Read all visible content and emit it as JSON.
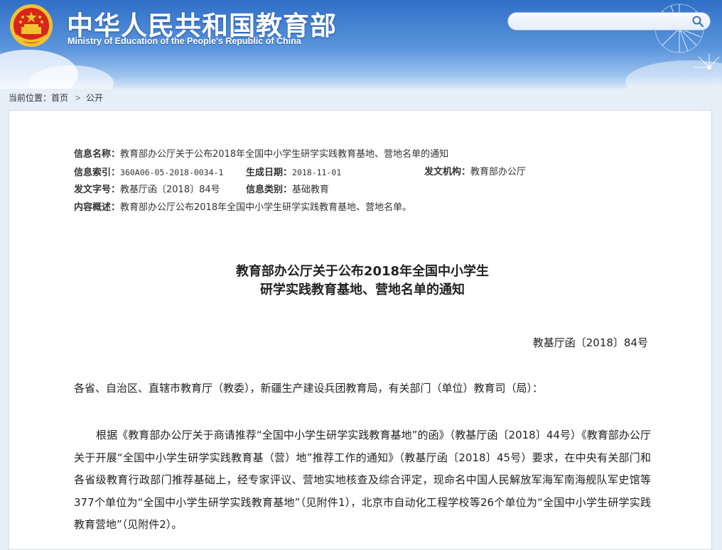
{
  "header": {
    "title": "中华人民共和国教育部",
    "subtitle": "Ministry of Education of the People's Republic of China",
    "search_placeholder": ""
  },
  "breadcrumb": {
    "prefix": "当前位置：",
    "items": [
      "首页",
      "公开"
    ]
  },
  "meta": {
    "info_name_label": "信息名称：",
    "info_name_value": "教育部办公厅关于公布2018年全国中小学生研学实践教育基地、营地名单的通知",
    "index_label": "信息索引：",
    "index_value": "360A06-05-2018-0034-1",
    "date_label": "生成日期：",
    "date_value": "2018-11-01",
    "issuer_label": "发文机构：",
    "issuer_value": "教育部办公厅",
    "doc_no_label": "发文字号：",
    "doc_no_value": "教基厅函〔2018〕84号",
    "category_label": "信息类别：",
    "category_value": "基础教育",
    "summary_label": "内容概述：",
    "summary_value": "教育部办公厅公布2018年全国中小学生研学实践教育基地、营地名单。"
  },
  "document": {
    "title_line1": "教育部办公厅关于公布2018年全国中小学生",
    "title_line2": "研学实践教育基地、营地名单的通知",
    "doc_number": "教基厅函〔2018〕84号",
    "salutation": "各省、自治区、直辖市教育厅（教委），新疆生产建设兵团教育局，有关部门（单位）教育司（局）：",
    "paragraph1": "根据《教育部办公厅关于商请推荐“全国中小学生研学实践教育基地”的函》（教基厅函〔2018〕44号）《教育部办公厅关于开展“全国中小学生研学实践教育基（营）地”推荐工作的通知》（教基厅函〔2018〕45号）要求，在中央有关部门和各省级教育行政部门推荐基础上，经专家评议、营地实地核查及综合评定，现命名中国人民解放军海军南海舰队军史馆等377个单位为“全国中小学生研学实践教育基地”（见附件1），北京市自动化工程学校等26个单位为“全国中小学生研学实践教育营地”（见附件2）。"
  },
  "colors": {
    "header_blue": "#2f6fc6",
    "emblem_red": "#d8261b",
    "emblem_gold": "#f2c230"
  },
  "icons": {
    "emblem": "national-emblem-icon",
    "search": "search-icon",
    "separator": "chevron-right-icon"
  }
}
